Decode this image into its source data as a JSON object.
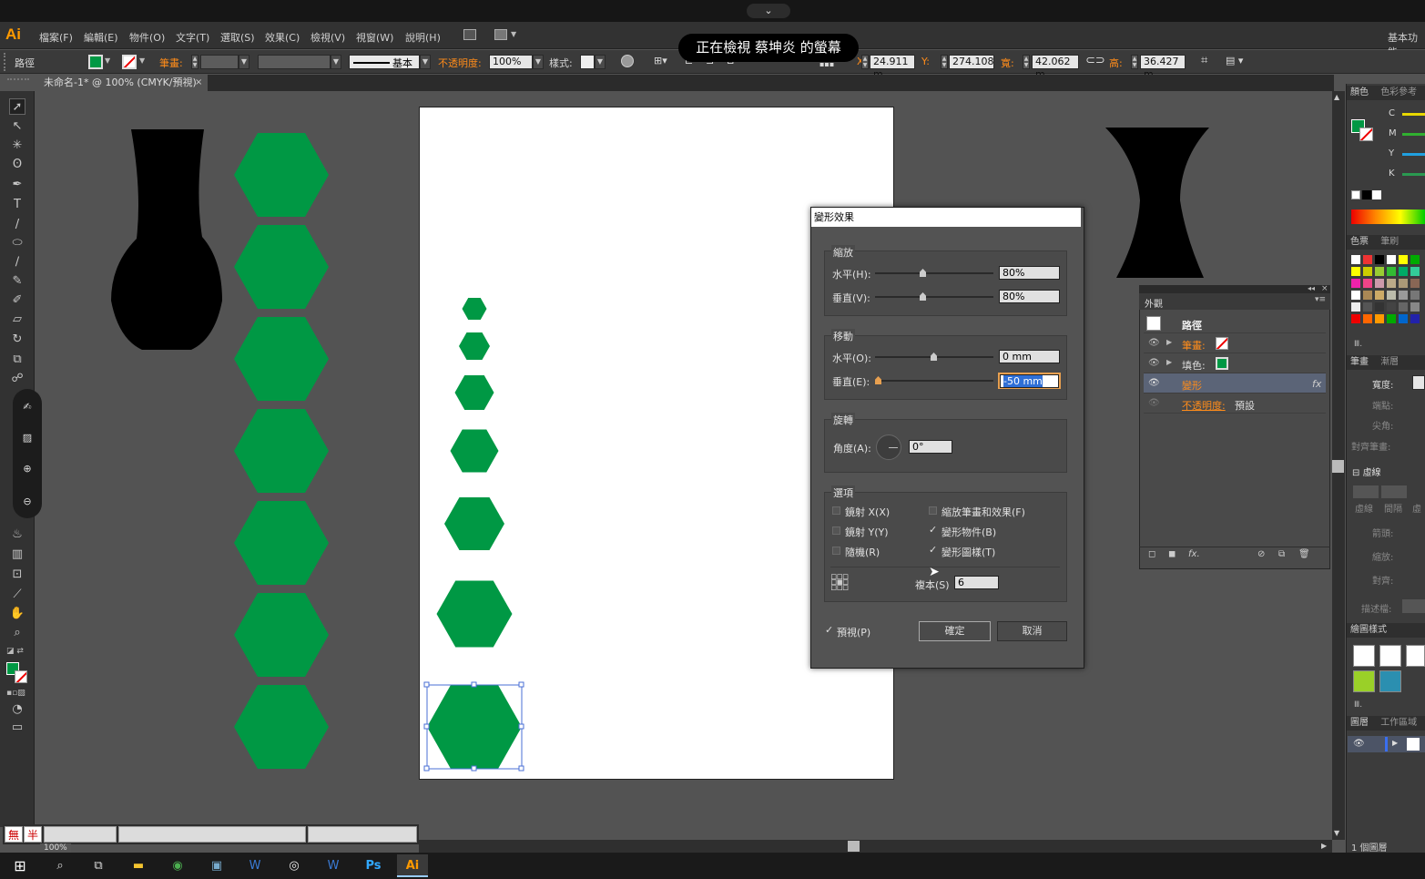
{
  "app": {
    "logo": "Ai",
    "workspace": "基本功能",
    "screen_share_banner": "正在檢視 蔡坤炎 的螢幕",
    "dropdown_glyph": "⌄"
  },
  "menu": [
    "檔案(F)",
    "編輯(E)",
    "物件(O)",
    "文字(T)",
    "選取(S)",
    "效果(C)",
    "檢視(V)",
    "視窗(W)",
    "說明(H)"
  ],
  "control": {
    "object_type": "路徑",
    "stroke_label": "筆畫:",
    "stroke_profile": "基本",
    "opacity_label": "不透明度:",
    "opacity_value": "100%",
    "style_label": "樣式:",
    "x_label": "X:",
    "x_value": "24.911 m",
    "y_label": "Y:",
    "y_value": "274.108",
    "w_label": "寬:",
    "w_value": "42.062 m",
    "h_label": "高:",
    "h_value": "36.427 m"
  },
  "document": {
    "tab_title": "未命名-1* @ 100% (CMYK/預視)",
    "close": "×"
  },
  "status": {
    "zoom": "100%",
    "ime_1": "無",
    "ime_2": "半"
  },
  "dialog": {
    "title": "變形效果",
    "scale": {
      "label": "縮放",
      "h_label": "水平(H):",
      "h_value": "80%",
      "v_label": "垂直(V):",
      "v_value": "80%"
    },
    "move": {
      "label": "移動",
      "h_label": "水平(O):",
      "h_value": "0 mm",
      "v_label": "垂直(E):",
      "v_value": "-50 mm"
    },
    "rotate": {
      "label": "旋轉",
      "angle_label": "角度(A):",
      "angle_value": "0°"
    },
    "options": {
      "label": "選項",
      "reflect_x": "鏡射 X(X)",
      "reflect_y": "鏡射 Y(Y)",
      "random": "隨機(R)",
      "scale_strokes": "縮放筆畫和效果(F)",
      "transform_objects": "變形物件(B)",
      "transform_patterns": "變形圖樣(T)",
      "copies_label": "複本(S)",
      "copies_value": "6"
    },
    "preview": "預視(P)",
    "ok": "確定",
    "cancel": "取消",
    "checks": {
      "reflect_x": false,
      "reflect_y": false,
      "random": false,
      "scale_strokes": false,
      "transform_objects": true,
      "transform_patterns": true,
      "preview": true
    }
  },
  "appearance": {
    "tab": "外觀",
    "title": "路徑",
    "stroke_label": "筆畫:",
    "fill_label": "填色:",
    "effect": "變形",
    "fx": "fx",
    "opacity_label": "不透明度:",
    "opacity_value": "預設"
  },
  "right_dock": {
    "color_tab": "顏色",
    "color_ref_tab": "色彩參考",
    "c": "C",
    "m": "M",
    "y": "Y",
    "k": "K",
    "swatches_tab": "色票",
    "brushes_tab": "筆刷",
    "stroke_tab": "筆畫",
    "gradient_tab": "漸層",
    "weight_label": "寬度:",
    "cap_label": "端點:",
    "corner_label": "尖角:",
    "align_label": "對齊筆畫:",
    "dashed": "虛線",
    "dash": "虛線",
    "gap": "間隔",
    "dash2": "虛",
    "arrow_label": "箭頭:",
    "scale_label": "縮放:",
    "align2_label": "對齊:",
    "profile_label": "描述檔:",
    "graphic_styles": "繪圖樣式",
    "layers_tab": "圖層",
    "artboards_tab": "工作區域",
    "layers_count": "1 個圖層"
  },
  "colors": {
    "accent_green": "#009844",
    "illustrator_orange": "#ff9a00",
    "panel": "#535353",
    "dark": "#323232"
  },
  "taskbar": [
    "windows-icon",
    "search-icon",
    "taskview-icon",
    "explorer-icon",
    "chrome-icon",
    "app-icon",
    "word-icon",
    "obs-icon",
    "word2-icon",
    "photoshop-icon",
    "illustrator-icon"
  ]
}
